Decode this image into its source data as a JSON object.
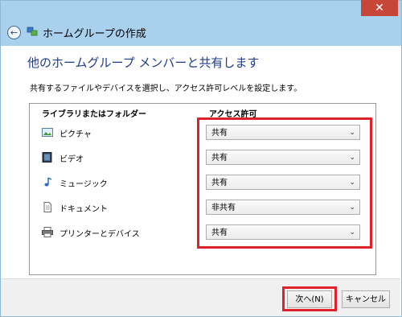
{
  "window": {
    "title": "ホームグループの作成",
    "close_symbol": "✕",
    "back_symbol": "←"
  },
  "main": {
    "heading": "他のホームグループ メンバーと共有します",
    "description": "共有するファイルやデバイスを選択し、アクセス許可レベルを設定します。"
  },
  "table": {
    "headers": {
      "library": "ライブラリまたはフォルダー",
      "permission": "アクセス許可"
    },
    "rows": [
      {
        "label": "ピクチャ",
        "value": "共有",
        "icon": "pictures-icon"
      },
      {
        "label": "ビデオ",
        "value": "共有",
        "icon": "videos-icon"
      },
      {
        "label": "ミュージック",
        "value": "共有",
        "icon": "music-icon"
      },
      {
        "label": "ドキュメント",
        "value": "非共有",
        "icon": "documents-icon"
      },
      {
        "label": "プリンターとデバイス",
        "value": "共有",
        "icon": "printer-icon"
      }
    ]
  },
  "footer": {
    "next_label": "次へ(N)",
    "cancel_label": "キャンセル"
  },
  "colors": {
    "titlebar": "#a9d1ee",
    "heading": "#1e3c8c",
    "highlight": "#e0202a",
    "close": "#c7463a"
  }
}
